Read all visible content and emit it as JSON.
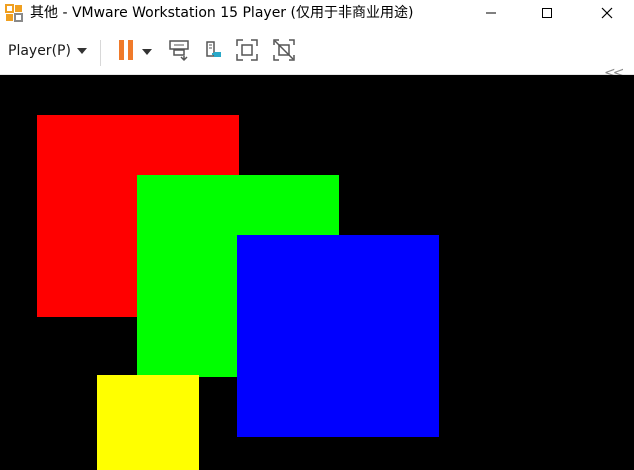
{
  "window": {
    "title": "其他 - VMware Workstation 15 Player (仅用于非商业用途)",
    "controls": {
      "minimize_icon": "minimize-icon",
      "maximize_icon": "maximize-icon",
      "close_icon": "close-icon"
    }
  },
  "toolbar": {
    "player_menu_label": "Player(P)",
    "icons": [
      "pause-icon",
      "send-ctrl-alt-del-icon",
      "removable-devices-icon",
      "full-screen-icon",
      "unity-icon"
    ],
    "collapse_label": "<<",
    "pause_color": "#f07a2a"
  },
  "guest_screen": {
    "background": "#000000",
    "shapes": [
      {
        "name": "red-square",
        "color": "#ff0000"
      },
      {
        "name": "green-square",
        "color": "#00ff00"
      },
      {
        "name": "blue-square",
        "color": "#0000ff"
      },
      {
        "name": "yellow-square",
        "color": "#ffff00"
      }
    ]
  }
}
